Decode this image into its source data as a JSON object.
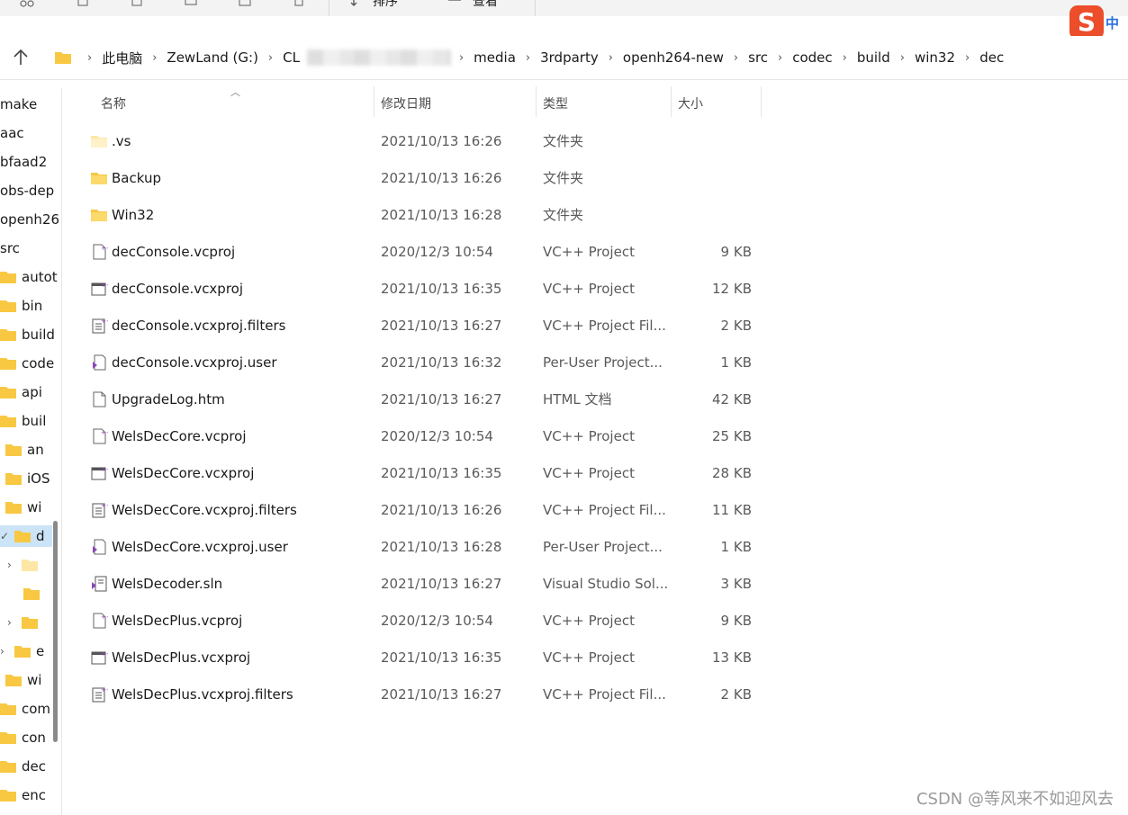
{
  "toolbar": {
    "sort_label": "排序",
    "view_label": "查看",
    "more_label": "···"
  },
  "ime": {
    "logo": "S",
    "lang": "中"
  },
  "address": {
    "crumbs": [
      "此电脑",
      "ZewLand (G:)",
      "CL",
      "media",
      "3rdparty",
      "openh264-new",
      "src",
      "codec",
      "build",
      "win32",
      "dec"
    ]
  },
  "columns": {
    "name": "名称",
    "date": "修改日期",
    "type": "类型",
    "size": "大小"
  },
  "nav": {
    "items": [
      {
        "label": "make",
        "icon": "none"
      },
      {
        "label": "aac",
        "icon": "none"
      },
      {
        "label": "bfaad2",
        "icon": "none"
      },
      {
        "label": "obs-dep",
        "icon": "none"
      },
      {
        "label": "openh26",
        "icon": "none"
      },
      {
        "label": "src",
        "icon": "none"
      },
      {
        "label": "autot",
        "icon": "folder"
      },
      {
        "label": "bin",
        "icon": "folder"
      },
      {
        "label": "build",
        "icon": "folder"
      },
      {
        "label": "code",
        "icon": "folder"
      },
      {
        "label": "api",
        "icon": "folder"
      },
      {
        "label": "buil",
        "icon": "folder"
      },
      {
        "label": "an",
        "icon": "folder"
      },
      {
        "label": "iOS",
        "icon": "folder"
      },
      {
        "label": "wi",
        "icon": "folder"
      },
      {
        "label": "d",
        "icon": "folder",
        "selected": true,
        "chevron": "✓"
      },
      {
        "label": "",
        "icon": "folder-light",
        "chevron": "›"
      },
      {
        "label": "",
        "icon": "folder"
      },
      {
        "label": "",
        "icon": "folder",
        "chevron": "›"
      },
      {
        "label": "e",
        "icon": "folder",
        "chevron": "›"
      },
      {
        "label": "wi",
        "icon": "folder"
      },
      {
        "label": "com",
        "icon": "folder"
      },
      {
        "label": "con",
        "icon": "folder"
      },
      {
        "label": "dec",
        "icon": "folder"
      },
      {
        "label": "enc",
        "icon": "folder"
      }
    ]
  },
  "files": [
    {
      "name": ".vs",
      "date": "2021/10/13 16:26",
      "type": "文件夹",
      "size": "",
      "icon": "folder-light-icon"
    },
    {
      "name": "Backup",
      "date": "2021/10/13 16:26",
      "type": "文件夹",
      "size": "",
      "icon": "folder-icon"
    },
    {
      "name": "Win32",
      "date": "2021/10/13 16:28",
      "type": "文件夹",
      "size": "",
      "icon": "folder-icon"
    },
    {
      "name": "decConsole.vcproj",
      "date": "2020/12/3 10:54",
      "type": "VC++ Project",
      "size": "9 KB",
      "icon": "vcproj-icon"
    },
    {
      "name": "decConsole.vcxproj",
      "date": "2021/10/13 16:35",
      "type": "VC++ Project",
      "size": "12 KB",
      "icon": "vcxproj-icon"
    },
    {
      "name": "decConsole.vcxproj.filters",
      "date": "2021/10/13 16:27",
      "type": "VC++ Project Fil...",
      "size": "2 KB",
      "icon": "filters-icon"
    },
    {
      "name": "decConsole.vcxproj.user",
      "date": "2021/10/13 16:32",
      "type": "Per-User Project...",
      "size": "1 KB",
      "icon": "user-file-icon"
    },
    {
      "name": "UpgradeLog.htm",
      "date": "2021/10/13 16:27",
      "type": "HTML 文档",
      "size": "42 KB",
      "icon": "html-file-icon"
    },
    {
      "name": "WelsDecCore.vcproj",
      "date": "2020/12/3 10:54",
      "type": "VC++ Project",
      "size": "25 KB",
      "icon": "vcproj-icon"
    },
    {
      "name": "WelsDecCore.vcxproj",
      "date": "2021/10/13 16:35",
      "type": "VC++ Project",
      "size": "28 KB",
      "icon": "vcxproj-icon"
    },
    {
      "name": "WelsDecCore.vcxproj.filters",
      "date": "2021/10/13 16:26",
      "type": "VC++ Project Fil...",
      "size": "11 KB",
      "icon": "filters-icon"
    },
    {
      "name": "WelsDecCore.vcxproj.user",
      "date": "2021/10/13 16:28",
      "type": "Per-User Project...",
      "size": "1 KB",
      "icon": "user-file-icon"
    },
    {
      "name": "WelsDecoder.sln",
      "date": "2021/10/13 16:27",
      "type": "Visual Studio Sol...",
      "size": "3 KB",
      "icon": "sln-icon"
    },
    {
      "name": "WelsDecPlus.vcproj",
      "date": "2020/12/3 10:54",
      "type": "VC++ Project",
      "size": "9 KB",
      "icon": "vcproj-icon"
    },
    {
      "name": "WelsDecPlus.vcxproj",
      "date": "2021/10/13 16:35",
      "type": "VC++ Project",
      "size": "13 KB",
      "icon": "vcxproj-icon"
    },
    {
      "name": "WelsDecPlus.vcxproj.filters",
      "date": "2021/10/13 16:27",
      "type": "VC++ Project Fil...",
      "size": "2 KB",
      "icon": "filters-icon"
    }
  ],
  "watermark": "CSDN @等风来不如迎风去",
  "colors": {
    "folder": "#f8c843",
    "folder_light": "#fde7a6",
    "selection": "#cce4f7",
    "vs_purple": "#8a46b8"
  }
}
